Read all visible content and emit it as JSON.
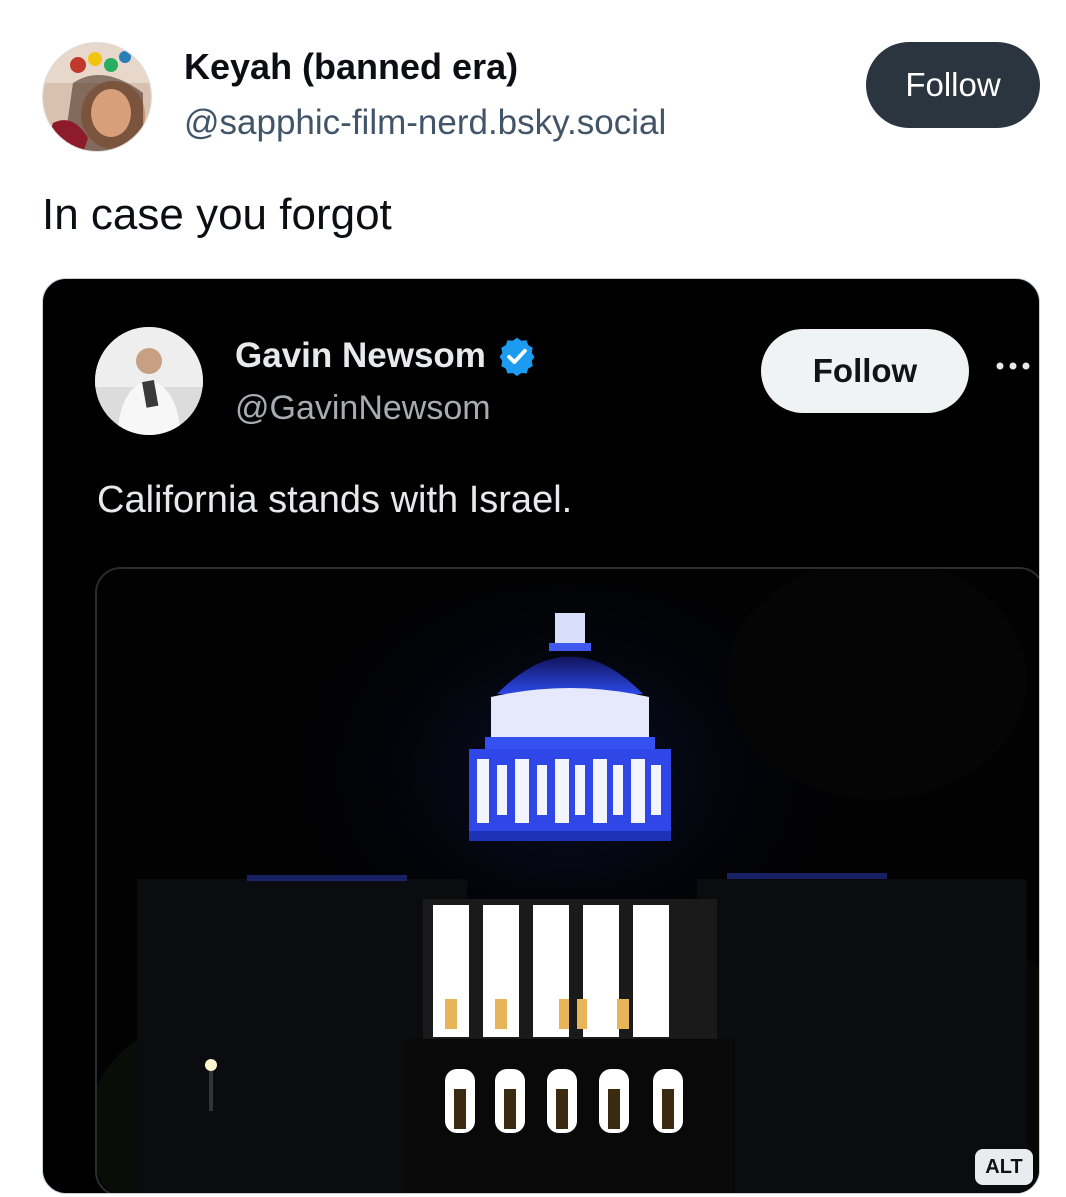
{
  "post": {
    "author": {
      "display_name": "Keyah (banned era)",
      "handle": "@sapphic-film-nerd.bsky.social"
    },
    "follow_label": "Follow",
    "text": "In case you forgot"
  },
  "embed": {
    "author": {
      "display_name": "Gavin Newsom",
      "handle": "@GavinNewsom",
      "verified_icon": "verified-badge-icon"
    },
    "follow_label": "Follow",
    "more_icon": "more-horizontal-icon",
    "text": "California stands with Israel.",
    "image_alt_label": "ALT"
  },
  "colors": {
    "follow_bg": "#2a3540",
    "verified_blue": "#1d9bf0",
    "dome_blue": "#2b48e8"
  }
}
